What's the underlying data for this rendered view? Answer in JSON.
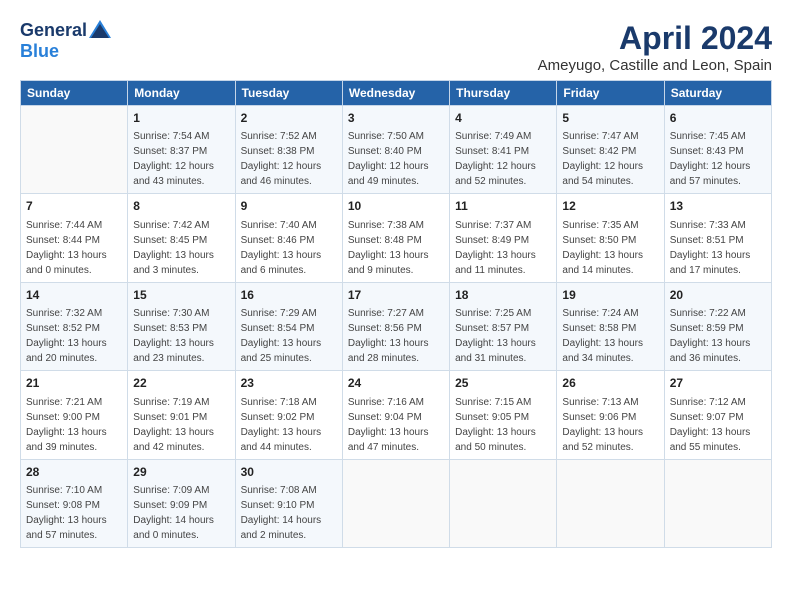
{
  "header": {
    "logo_general": "General",
    "logo_blue": "Blue",
    "month": "April 2024",
    "location": "Ameyugo, Castille and Leon, Spain"
  },
  "calendar": {
    "days_of_week": [
      "Sunday",
      "Monday",
      "Tuesday",
      "Wednesday",
      "Thursday",
      "Friday",
      "Saturday"
    ],
    "weeks": [
      [
        {
          "day": "",
          "info": ""
        },
        {
          "day": "1",
          "info": "Sunrise: 7:54 AM\nSunset: 8:37 PM\nDaylight: 12 hours\nand 43 minutes."
        },
        {
          "day": "2",
          "info": "Sunrise: 7:52 AM\nSunset: 8:38 PM\nDaylight: 12 hours\nand 46 minutes."
        },
        {
          "day": "3",
          "info": "Sunrise: 7:50 AM\nSunset: 8:40 PM\nDaylight: 12 hours\nand 49 minutes."
        },
        {
          "day": "4",
          "info": "Sunrise: 7:49 AM\nSunset: 8:41 PM\nDaylight: 12 hours\nand 52 minutes."
        },
        {
          "day": "5",
          "info": "Sunrise: 7:47 AM\nSunset: 8:42 PM\nDaylight: 12 hours\nand 54 minutes."
        },
        {
          "day": "6",
          "info": "Sunrise: 7:45 AM\nSunset: 8:43 PM\nDaylight: 12 hours\nand 57 minutes."
        }
      ],
      [
        {
          "day": "7",
          "info": "Sunrise: 7:44 AM\nSunset: 8:44 PM\nDaylight: 13 hours\nand 0 minutes."
        },
        {
          "day": "8",
          "info": "Sunrise: 7:42 AM\nSunset: 8:45 PM\nDaylight: 13 hours\nand 3 minutes."
        },
        {
          "day": "9",
          "info": "Sunrise: 7:40 AM\nSunset: 8:46 PM\nDaylight: 13 hours\nand 6 minutes."
        },
        {
          "day": "10",
          "info": "Sunrise: 7:38 AM\nSunset: 8:48 PM\nDaylight: 13 hours\nand 9 minutes."
        },
        {
          "day": "11",
          "info": "Sunrise: 7:37 AM\nSunset: 8:49 PM\nDaylight: 13 hours\nand 11 minutes."
        },
        {
          "day": "12",
          "info": "Sunrise: 7:35 AM\nSunset: 8:50 PM\nDaylight: 13 hours\nand 14 minutes."
        },
        {
          "day": "13",
          "info": "Sunrise: 7:33 AM\nSunset: 8:51 PM\nDaylight: 13 hours\nand 17 minutes."
        }
      ],
      [
        {
          "day": "14",
          "info": "Sunrise: 7:32 AM\nSunset: 8:52 PM\nDaylight: 13 hours\nand 20 minutes."
        },
        {
          "day": "15",
          "info": "Sunrise: 7:30 AM\nSunset: 8:53 PM\nDaylight: 13 hours\nand 23 minutes."
        },
        {
          "day": "16",
          "info": "Sunrise: 7:29 AM\nSunset: 8:54 PM\nDaylight: 13 hours\nand 25 minutes."
        },
        {
          "day": "17",
          "info": "Sunrise: 7:27 AM\nSunset: 8:56 PM\nDaylight: 13 hours\nand 28 minutes."
        },
        {
          "day": "18",
          "info": "Sunrise: 7:25 AM\nSunset: 8:57 PM\nDaylight: 13 hours\nand 31 minutes."
        },
        {
          "day": "19",
          "info": "Sunrise: 7:24 AM\nSunset: 8:58 PM\nDaylight: 13 hours\nand 34 minutes."
        },
        {
          "day": "20",
          "info": "Sunrise: 7:22 AM\nSunset: 8:59 PM\nDaylight: 13 hours\nand 36 minutes."
        }
      ],
      [
        {
          "day": "21",
          "info": "Sunrise: 7:21 AM\nSunset: 9:00 PM\nDaylight: 13 hours\nand 39 minutes."
        },
        {
          "day": "22",
          "info": "Sunrise: 7:19 AM\nSunset: 9:01 PM\nDaylight: 13 hours\nand 42 minutes."
        },
        {
          "day": "23",
          "info": "Sunrise: 7:18 AM\nSunset: 9:02 PM\nDaylight: 13 hours\nand 44 minutes."
        },
        {
          "day": "24",
          "info": "Sunrise: 7:16 AM\nSunset: 9:04 PM\nDaylight: 13 hours\nand 47 minutes."
        },
        {
          "day": "25",
          "info": "Sunrise: 7:15 AM\nSunset: 9:05 PM\nDaylight: 13 hours\nand 50 minutes."
        },
        {
          "day": "26",
          "info": "Sunrise: 7:13 AM\nSunset: 9:06 PM\nDaylight: 13 hours\nand 52 minutes."
        },
        {
          "day": "27",
          "info": "Sunrise: 7:12 AM\nSunset: 9:07 PM\nDaylight: 13 hours\nand 55 minutes."
        }
      ],
      [
        {
          "day": "28",
          "info": "Sunrise: 7:10 AM\nSunset: 9:08 PM\nDaylight: 13 hours\nand 57 minutes."
        },
        {
          "day": "29",
          "info": "Sunrise: 7:09 AM\nSunset: 9:09 PM\nDaylight: 14 hours\nand 0 minutes."
        },
        {
          "day": "30",
          "info": "Sunrise: 7:08 AM\nSunset: 9:10 PM\nDaylight: 14 hours\nand 2 minutes."
        },
        {
          "day": "",
          "info": ""
        },
        {
          "day": "",
          "info": ""
        },
        {
          "day": "",
          "info": ""
        },
        {
          "day": "",
          "info": ""
        }
      ]
    ]
  }
}
